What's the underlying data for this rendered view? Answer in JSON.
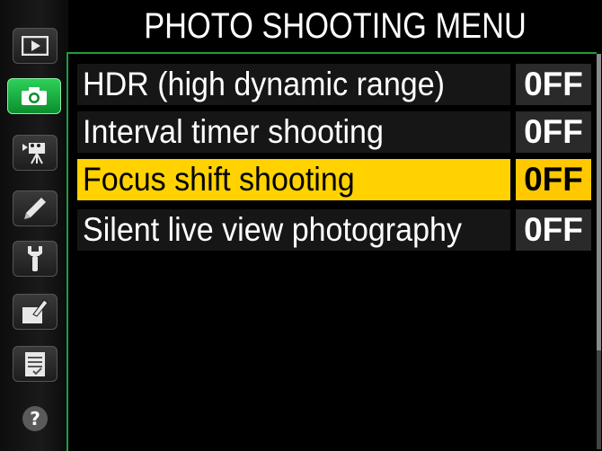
{
  "header": {
    "title": "PHOTO SHOOTING MENU"
  },
  "sidebar": {
    "tabs": [
      {
        "icon": "playback-icon",
        "active": false
      },
      {
        "icon": "camera-icon",
        "active": true
      },
      {
        "icon": "movie-camera-icon",
        "active": false
      },
      {
        "icon": "pencil-icon",
        "active": false
      },
      {
        "icon": "wrench-icon",
        "active": false
      },
      {
        "icon": "retouch-icon",
        "active": false
      },
      {
        "icon": "my-menu-icon",
        "active": false
      },
      {
        "icon": "help-icon",
        "active": false
      }
    ]
  },
  "menu": {
    "items": [
      {
        "label": "HDR (high dynamic range)",
        "value": "0FF"
      },
      {
        "label": "Interval timer shooting",
        "value": "0FF"
      },
      {
        "label": "Focus shift shooting",
        "value": "0FF",
        "selected": true
      },
      {
        "label": "Silent live view photography",
        "value": "0FF"
      }
    ]
  },
  "colors": {
    "highlight": "#ffd200",
    "active_tab": "#1fb548",
    "frame": "#1aa03a"
  }
}
